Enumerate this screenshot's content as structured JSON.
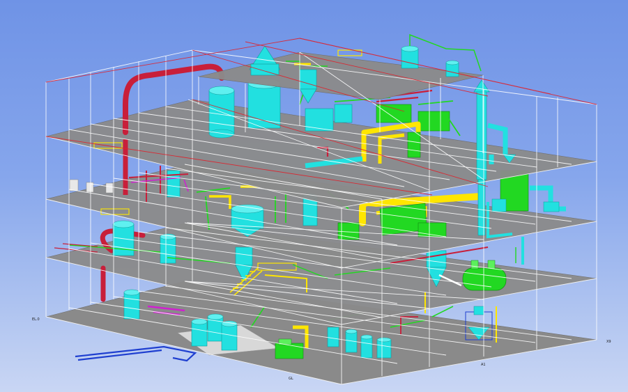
{
  "viewport": {
    "background_top": "#6f93e6",
    "background_bottom": "#c9d6f4"
  },
  "scene": {
    "floor_color": "#8a8a8a",
    "grid_color": "#ffffff",
    "grid_highlight_color": "#e0202a",
    "equipment_color": "#22e0e0",
    "steel_color": "#ffe600",
    "package_color": "#22d822",
    "pipe_red_color": "#c81f3a",
    "pipe_magenta_color": "#d020d0",
    "pipe_blue_color": "#1f3fd0",
    "floors": 4,
    "icons": [
      "vessel-icon",
      "cyclone-icon",
      "stack-icon",
      "heat-exchanger-icon",
      "stair-icon"
    ]
  },
  "annotations": {
    "left_tag": "EL.0",
    "bottom_tag_1": "GL",
    "bottom_tag_2": "A1",
    "right_tag": "X9"
  }
}
